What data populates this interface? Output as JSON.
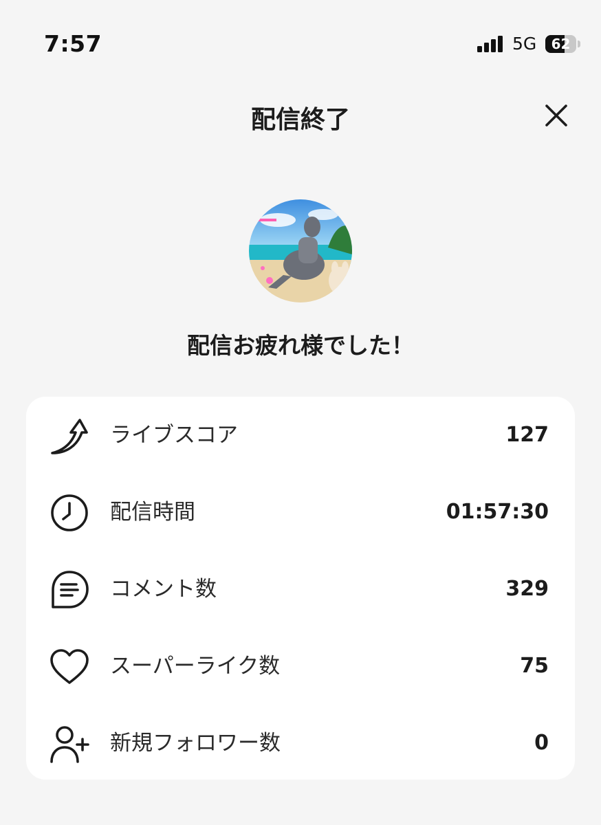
{
  "status_bar": {
    "time": "7:57",
    "network": "5G",
    "battery_level": "62",
    "battery_fraction": 0.62
  },
  "header": {
    "title": "配信終了",
    "close_icon": "close-icon"
  },
  "avatar": {
    "icon": "stream-thumbnail-avatar"
  },
  "message": "配信お疲れ様でした！",
  "stats": [
    {
      "icon": "trend-arrow-icon",
      "label": "ライブスコア",
      "value": "127"
    },
    {
      "icon": "clock-icon",
      "label": "配信時間",
      "value": "01:57:30"
    },
    {
      "icon": "comment-icon",
      "label": "コメント数",
      "value": "329"
    },
    {
      "icon": "heart-icon",
      "label": "スーパーライク数",
      "value": "75"
    },
    {
      "icon": "add-user-icon",
      "label": "新規フォロワー数",
      "value": "0"
    }
  ],
  "colors": {
    "background": "#f5f5f5",
    "card": "#ffffff",
    "text": "#1c1c1c"
  }
}
